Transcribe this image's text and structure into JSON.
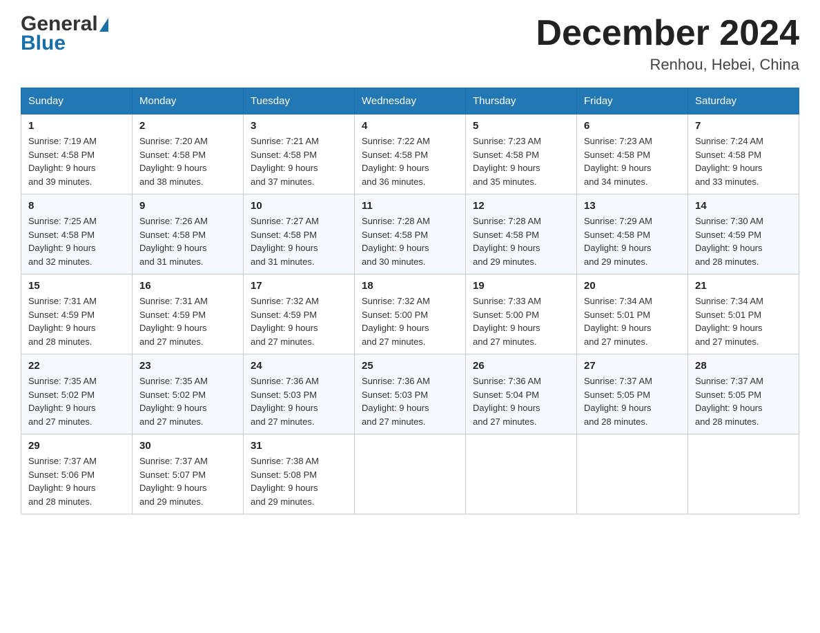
{
  "header": {
    "logo": {
      "general": "General",
      "blue": "Blue",
      "tagline": "Blue"
    },
    "title": "December 2024",
    "location": "Renhou, Hebei, China"
  },
  "days_of_week": [
    "Sunday",
    "Monday",
    "Tuesday",
    "Wednesday",
    "Thursday",
    "Friday",
    "Saturday"
  ],
  "weeks": [
    [
      {
        "day": "1",
        "sunrise": "7:19 AM",
        "sunset": "4:58 PM",
        "daylight": "9 hours and 39 minutes."
      },
      {
        "day": "2",
        "sunrise": "7:20 AM",
        "sunset": "4:58 PM",
        "daylight": "9 hours and 38 minutes."
      },
      {
        "day": "3",
        "sunrise": "7:21 AM",
        "sunset": "4:58 PM",
        "daylight": "9 hours and 37 minutes."
      },
      {
        "day": "4",
        "sunrise": "7:22 AM",
        "sunset": "4:58 PM",
        "daylight": "9 hours and 36 minutes."
      },
      {
        "day": "5",
        "sunrise": "7:23 AM",
        "sunset": "4:58 PM",
        "daylight": "9 hours and 35 minutes."
      },
      {
        "day": "6",
        "sunrise": "7:23 AM",
        "sunset": "4:58 PM",
        "daylight": "9 hours and 34 minutes."
      },
      {
        "day": "7",
        "sunrise": "7:24 AM",
        "sunset": "4:58 PM",
        "daylight": "9 hours and 33 minutes."
      }
    ],
    [
      {
        "day": "8",
        "sunrise": "7:25 AM",
        "sunset": "4:58 PM",
        "daylight": "9 hours and 32 minutes."
      },
      {
        "day": "9",
        "sunrise": "7:26 AM",
        "sunset": "4:58 PM",
        "daylight": "9 hours and 31 minutes."
      },
      {
        "day": "10",
        "sunrise": "7:27 AM",
        "sunset": "4:58 PM",
        "daylight": "9 hours and 31 minutes."
      },
      {
        "day": "11",
        "sunrise": "7:28 AM",
        "sunset": "4:58 PM",
        "daylight": "9 hours and 30 minutes."
      },
      {
        "day": "12",
        "sunrise": "7:28 AM",
        "sunset": "4:58 PM",
        "daylight": "9 hours and 29 minutes."
      },
      {
        "day": "13",
        "sunrise": "7:29 AM",
        "sunset": "4:58 PM",
        "daylight": "9 hours and 29 minutes."
      },
      {
        "day": "14",
        "sunrise": "7:30 AM",
        "sunset": "4:59 PM",
        "daylight": "9 hours and 28 minutes."
      }
    ],
    [
      {
        "day": "15",
        "sunrise": "7:31 AM",
        "sunset": "4:59 PM",
        "daylight": "9 hours and 28 minutes."
      },
      {
        "day": "16",
        "sunrise": "7:31 AM",
        "sunset": "4:59 PM",
        "daylight": "9 hours and 27 minutes."
      },
      {
        "day": "17",
        "sunrise": "7:32 AM",
        "sunset": "4:59 PM",
        "daylight": "9 hours and 27 minutes."
      },
      {
        "day": "18",
        "sunrise": "7:32 AM",
        "sunset": "5:00 PM",
        "daylight": "9 hours and 27 minutes."
      },
      {
        "day": "19",
        "sunrise": "7:33 AM",
        "sunset": "5:00 PM",
        "daylight": "9 hours and 27 minutes."
      },
      {
        "day": "20",
        "sunrise": "7:34 AM",
        "sunset": "5:01 PM",
        "daylight": "9 hours and 27 minutes."
      },
      {
        "day": "21",
        "sunrise": "7:34 AM",
        "sunset": "5:01 PM",
        "daylight": "9 hours and 27 minutes."
      }
    ],
    [
      {
        "day": "22",
        "sunrise": "7:35 AM",
        "sunset": "5:02 PM",
        "daylight": "9 hours and 27 minutes."
      },
      {
        "day": "23",
        "sunrise": "7:35 AM",
        "sunset": "5:02 PM",
        "daylight": "9 hours and 27 minutes."
      },
      {
        "day": "24",
        "sunrise": "7:36 AM",
        "sunset": "5:03 PM",
        "daylight": "9 hours and 27 minutes."
      },
      {
        "day": "25",
        "sunrise": "7:36 AM",
        "sunset": "5:03 PM",
        "daylight": "9 hours and 27 minutes."
      },
      {
        "day": "26",
        "sunrise": "7:36 AM",
        "sunset": "5:04 PM",
        "daylight": "9 hours and 27 minutes."
      },
      {
        "day": "27",
        "sunrise": "7:37 AM",
        "sunset": "5:05 PM",
        "daylight": "9 hours and 28 minutes."
      },
      {
        "day": "28",
        "sunrise": "7:37 AM",
        "sunset": "5:05 PM",
        "daylight": "9 hours and 28 minutes."
      }
    ],
    [
      {
        "day": "29",
        "sunrise": "7:37 AM",
        "sunset": "5:06 PM",
        "daylight": "9 hours and 28 minutes."
      },
      {
        "day": "30",
        "sunrise": "7:37 AM",
        "sunset": "5:07 PM",
        "daylight": "9 hours and 29 minutes."
      },
      {
        "day": "31",
        "sunrise": "7:38 AM",
        "sunset": "5:08 PM",
        "daylight": "9 hours and 29 minutes."
      },
      null,
      null,
      null,
      null
    ]
  ],
  "labels": {
    "sunrise": "Sunrise:",
    "sunset": "Sunset:",
    "daylight": "Daylight:"
  }
}
